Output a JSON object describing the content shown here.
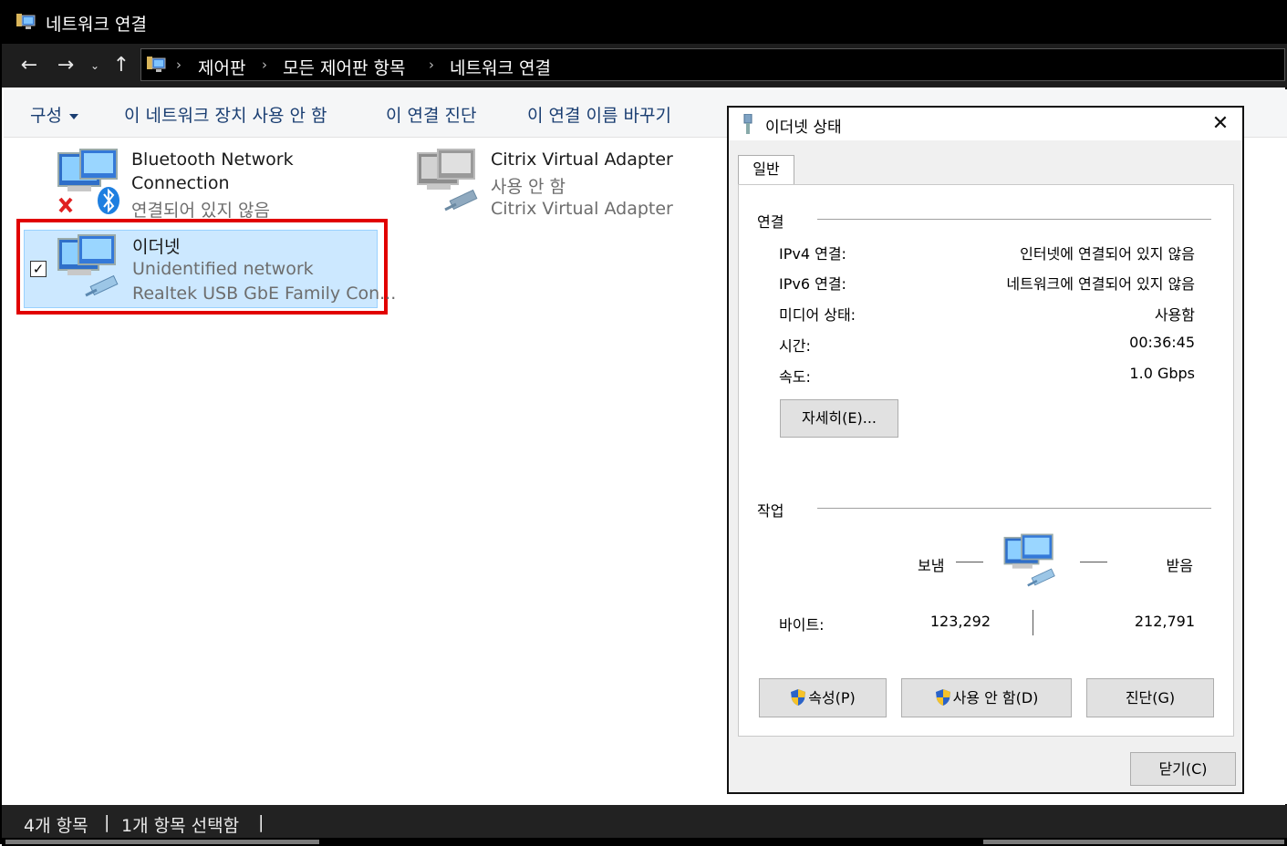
{
  "window": {
    "title": "네트워크 연결",
    "icon": "network-connections-icon"
  },
  "nav": {
    "back": "←",
    "forward": "→",
    "recent": "⌄",
    "up": "↑",
    "breadcrumbs": [
      "제어판",
      "모든 제어판 항목",
      "네트워크 연결"
    ],
    "separator": "›"
  },
  "toolbar": {
    "organize": "구성",
    "disable": "이 네트워크 장치 사용 안 함",
    "diagnose": "이 연결 진단",
    "rename": "이 연결 이름 바꾸기"
  },
  "connections": [
    {
      "name": "Bluetooth Network",
      "name2": "Connection",
      "status": "연결되어 있지 않음",
      "icon": "bluetooth-network-icon"
    },
    {
      "name": "Citrix Virtual Adapter",
      "status": "사용 안 함",
      "device": "Citrix Virtual Adapter",
      "icon": "disabled-network-icon"
    },
    {
      "name": "이더넷",
      "status": "Unidentified network",
      "device": "Realtek USB GbE Family Con...",
      "icon": "ethernet-network-icon",
      "checked": "✓"
    }
  ],
  "statusbar": {
    "count": "4개 항목",
    "sep": "|",
    "selected": "1개 항목 선택함",
    "sep2": "|"
  },
  "dialog": {
    "title": "이더넷 상태",
    "close": "✕",
    "tab": "일반",
    "connection_group": "연결",
    "rows": [
      {
        "label": "IPv4 연결:",
        "value": "인터넷에 연결되어 있지 않음"
      },
      {
        "label": "IPv6 연결:",
        "value": "네트워크에 연결되어 있지 않음"
      },
      {
        "label": "미디어 상태:",
        "value": "사용함"
      },
      {
        "label": "시간:",
        "value": "00:36:45"
      },
      {
        "label": "속도:",
        "value": "1.0 Gbps"
      }
    ],
    "details_button": "자세히(E)...",
    "activity_group": "작업",
    "sent": "보냄",
    "received": "받음",
    "bytes_label": "바이트:",
    "bytes_sent": "123,292",
    "bytes_received": "212,791",
    "properties_button": "속성(P)",
    "disable_button": "사용 안 함(D)",
    "diagnose_button": "진단(G)",
    "close_button": "닫기(C)"
  },
  "colors": {
    "selection": "#cce8ff",
    "highlight_border": "#e10000",
    "link_text": "#1a3e72"
  }
}
